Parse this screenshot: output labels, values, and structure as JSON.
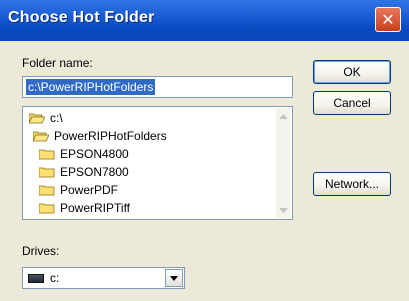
{
  "window": {
    "title": "Choose Hot Folder",
    "close_glyph": "✕"
  },
  "folder_name": {
    "label": "Folder name:",
    "value": "c:\\PowerRIPHotFolders"
  },
  "folder_tree": [
    {
      "label": "c:\\",
      "icon": "open-folder-icon"
    },
    {
      "label": "PowerRIPHotFolders",
      "icon": "open-folder-icon"
    },
    {
      "label": "EPSON4800",
      "icon": "folder-icon"
    },
    {
      "label": "EPSON7800",
      "icon": "folder-icon"
    },
    {
      "label": "PowerPDF",
      "icon": "folder-icon"
    },
    {
      "label": "PowerRIPTiff",
      "icon": "folder-icon"
    }
  ],
  "buttons": {
    "ok": "OK",
    "cancel": "Cancel",
    "network": "Network..."
  },
  "drives": {
    "label": "Drives:",
    "selected": "c:",
    "icon": "drive-icon"
  },
  "colors": {
    "titlebar": "#0a4ac0",
    "selection": "#316ac5",
    "dialog_bg": "#ece9d8"
  }
}
